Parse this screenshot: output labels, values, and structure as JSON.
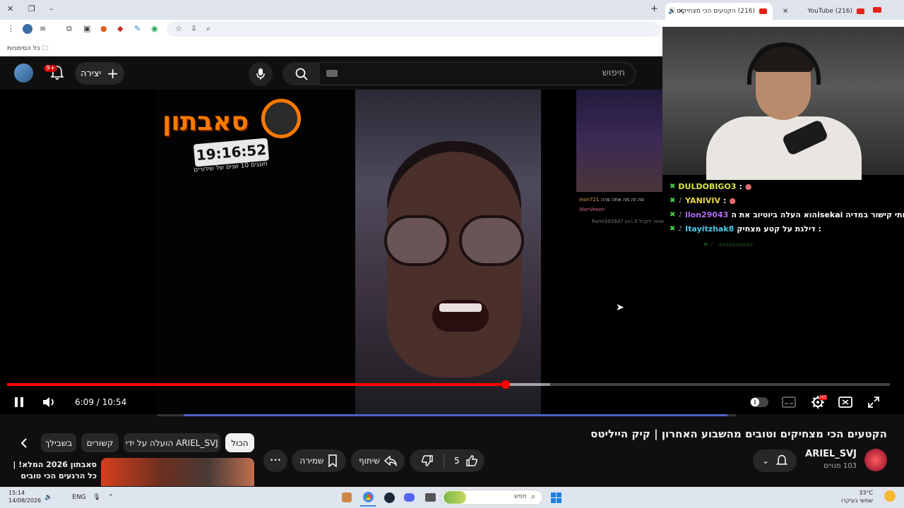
{
  "browser": {
    "tabs": [
      {
        "label": "(216) YouTube",
        "active": false
      },
      {
        "label": "(216) הקטעים הכי מצחיקים",
        "active": true
      }
    ],
    "new_tab": "+",
    "bookmarks_label": "כל הסימניות",
    "min_glyph": "–",
    "restore_glyph": "❐"
  },
  "header": {
    "search_placeholder": "חיפוש",
    "create_label": "יצירה",
    "notif_badge": "9+"
  },
  "overlay": {
    "logo_text": "סאבתון",
    "timer": "19:16:52",
    "timer_sub": "חוגגים 10 שנים של שידורים"
  },
  "chat": [
    {
      "user": "DULDOBIGO3",
      "msg": ":",
      "color": "#d8e84a"
    },
    {
      "user": "YANIVIV",
      "msg": ":",
      "color": "#e8d84a"
    },
    {
      "user": "llon29043",
      "msg": ": שלחתי קישור במדיה isekaiהוא העלה ביוטיוב את ה",
      "color": "#b06cf0"
    },
    {
      "user": "Itayitzhak8",
      "msg": ": דילגת על קטע מצחיק",
      "color": "#4ac8e8"
    }
  ],
  "chat_faded": "✖ ✓ :aaaaaaaaaa",
  "mini_chat": [
    {
      "user": "inon721",
      "msg": "מה זה מה אתה פרה"
    },
    {
      "user": "IdanVexon",
      "msg": ""
    },
    {
      "user": "Rami393937",
      "msg": "אמור לקהל 5 רגע"
    }
  ],
  "player": {
    "current": "6:09",
    "duration": "10:54",
    "time_text": "6:09 / 10:54",
    "played_fraction": 0.565,
    "buffered_fraction": 0.615,
    "hd_badge": "HD"
  },
  "video": {
    "title": "הקטעים הכי מצחיקים וטובים מהשבוע האחרון | קיק הייליטס",
    "channel": "ARIEL_SVJ",
    "subscribers": "103 מנויים",
    "likes": "5",
    "share_label": "שיתוף",
    "save_label": "שמירה",
    "more_glyph": "•••"
  },
  "chips": [
    {
      "label": "הכול",
      "selected": true
    },
    {
      "label": "הועלה על ידי ARIEL_SVJ",
      "selected": false
    },
    {
      "label": "קשורים",
      "selected": false
    },
    {
      "label": "בשבילך",
      "selected": false
    }
  ],
  "recommended": {
    "title": "סאבתון 2026 המלא! | כל הרגעים הכי טובים"
  },
  "taskbar": {
    "time": "15:14",
    "date": "14/08/2026",
    "lang": "ENG",
    "search_label": "חפש",
    "temp": "33°C",
    "weather_desc": "שמשי בעיקרו"
  },
  "colors": {
    "accent_red": "#ff0000",
    "bg": "#0f0f0f",
    "chip_bg": "#272727"
  }
}
